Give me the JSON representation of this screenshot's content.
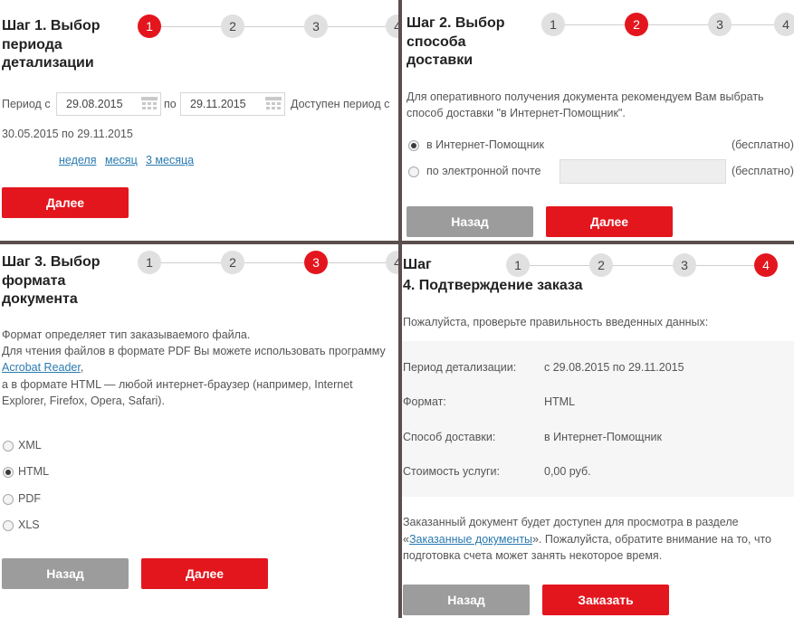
{
  "step_numbers": [
    "1",
    "2",
    "3",
    "4"
  ],
  "step1": {
    "title": "Шаг 1. Выбор периода детализации",
    "period_label": "Период с",
    "date_from": "29.08.2015",
    "to_label": "по",
    "date_to": "29.11.2015",
    "available_line1": "Доступен период с",
    "available_line2": "30.05.2015 по 29.11.2015",
    "quick_links": [
      "неделя",
      "месяц",
      "3 месяца"
    ],
    "next_label": "Далее"
  },
  "step2": {
    "title": "Шаг 2. Выбор способа доставки",
    "description": "Для оперативного получения документа рекомендуем Вам выбрать способ доставки \"в Интернет-Помощник\".",
    "options": [
      {
        "label": "в Интернет-Помощник",
        "price": "(бесплатно)",
        "selected": true
      },
      {
        "label": "по электронной почте",
        "price": "(бесплатно)",
        "selected": false
      }
    ],
    "email_value": "",
    "back_label": "Назад",
    "next_label": "Далее"
  },
  "step3": {
    "title": "Шаг 3. Выбор формата документа",
    "desc_line1": "Формат определяет тип заказываемого файла.",
    "desc_line2": "Для чтения файлов в формате PDF Вы можете использовать программу",
    "acrobat_link": "Acrobat Reader",
    "desc_after_link": ",",
    "desc_line3": "а в формате HTML — любой интернет-браузер (например, Internet Explorer, Firefox, Opera, Safari).",
    "formats": [
      {
        "label": "XML",
        "selected": false
      },
      {
        "label": "HTML",
        "selected": true
      },
      {
        "label": "PDF",
        "selected": false
      },
      {
        "label": "XLS",
        "selected": false
      }
    ],
    "back_label": "Назад",
    "next_label": "Далее"
  },
  "step4": {
    "title_line1": "Шаг",
    "title_line2": "4. Подтверждение заказа",
    "check_text": "Пожалуйста, проверьте правильность введенных данных:",
    "rows": [
      {
        "label": "Период детализации:",
        "value": "с 29.08.2015 по 29.11.2015"
      },
      {
        "label": "Формат:",
        "value": "HTML"
      },
      {
        "label": "Способ доставки:",
        "value": "в Интернет-Помощник"
      },
      {
        "label": "Стоимость услуги:",
        "value": "0,00 руб."
      }
    ],
    "note_line1": "Заказанный документ будет доступен для просмотра в разделе",
    "note_quote_open": "«",
    "note_link": "Заказанные документы",
    "note_rest": "». Пожалуйста, обратите внимание на то, что подготовка счета может занять некоторое время.",
    "back_label": "Назад",
    "order_label": "Заказать"
  }
}
